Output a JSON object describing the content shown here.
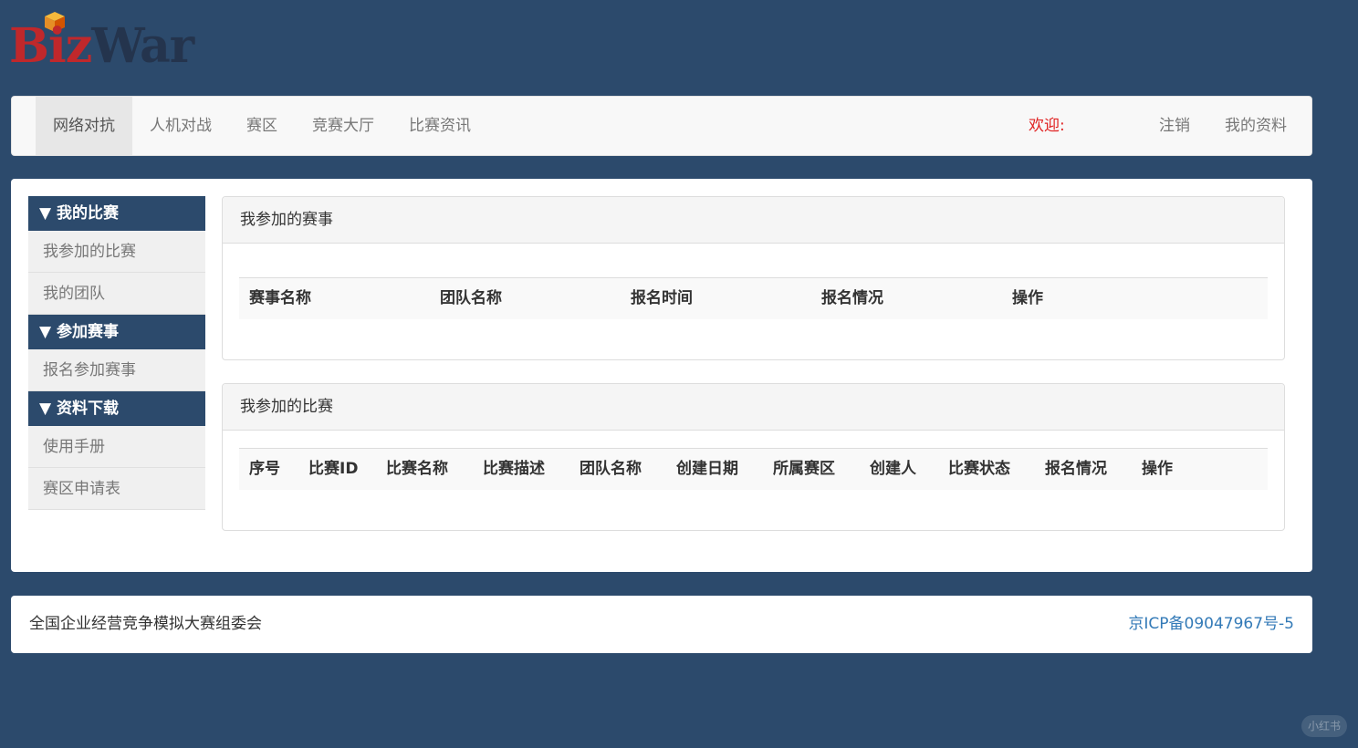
{
  "brand": {
    "logo_left": "Biz",
    "logo_right": "War"
  },
  "navbar": {
    "items": [
      {
        "label": "网络对抗",
        "active": true
      },
      {
        "label": "人机对战"
      },
      {
        "label": "赛区"
      },
      {
        "label": "竞赛大厅"
      },
      {
        "label": "比赛资讯"
      }
    ],
    "welcome": "欢迎:",
    "logout": "注销",
    "profile": "我的资料"
  },
  "sidebar": {
    "groups": [
      {
        "header": "▼ 我的比赛",
        "items": [
          "我参加的比赛",
          "我的团队"
        ]
      },
      {
        "header": "▼ 参加赛事",
        "items": [
          "报名参加赛事"
        ]
      },
      {
        "header": "▼ 资料下载",
        "items": [
          "使用手册",
          "赛区申请表"
        ]
      }
    ]
  },
  "events_panel": {
    "title": "我参加的赛事",
    "columns": [
      "赛事名称",
      "团队名称",
      "报名时间",
      "报名情况",
      "操作"
    ]
  },
  "matches_panel": {
    "title": "我参加的比赛",
    "columns": [
      "序号",
      "比赛ID",
      "比赛名称",
      "比赛描述",
      "团队名称",
      "创建日期",
      "所属赛区",
      "创建人",
      "比赛状态",
      "报名情况",
      "操作"
    ]
  },
  "footer": {
    "org": "全国企业经营竞争模拟大赛组委会",
    "icp": "京ICP备09047967号-5"
  },
  "watermark": "小红书",
  "colors": {
    "background": "#2c4a6c",
    "accent_red": "#e02020",
    "link_blue": "#337ab7"
  }
}
